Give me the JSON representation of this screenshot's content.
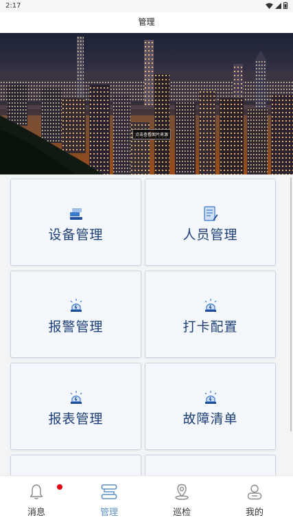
{
  "status_bar": {
    "time": "2:17",
    "icons": [
      "wifi-icon",
      "signal-icon",
      "battery-icon"
    ]
  },
  "header": {
    "title": "管理"
  },
  "banner": {
    "caption": "点击查看图片来源"
  },
  "cards": [
    {
      "label": "设备管理",
      "icon": "device-stack-icon"
    },
    {
      "label": "人员管理",
      "icon": "document-icon"
    },
    {
      "label": "报警管理",
      "icon": "alarm-light-icon"
    },
    {
      "label": "打卡配置",
      "icon": "alarm-light-icon"
    },
    {
      "label": "报表管理",
      "icon": "alarm-light-icon"
    },
    {
      "label": "故障清单",
      "icon": "alarm-light-icon"
    }
  ],
  "tabs": [
    {
      "label": "消息",
      "icon": "bell-icon",
      "badge": true
    },
    {
      "label": "管理",
      "icon": "manage-icon",
      "active": true
    },
    {
      "label": "巡检",
      "icon": "location-pin-icon"
    },
    {
      "label": "我的",
      "icon": "user-icon"
    }
  ],
  "colors": {
    "card_text": "#1c3f78",
    "accent": "#5f92c7",
    "badge": "#e60012"
  }
}
